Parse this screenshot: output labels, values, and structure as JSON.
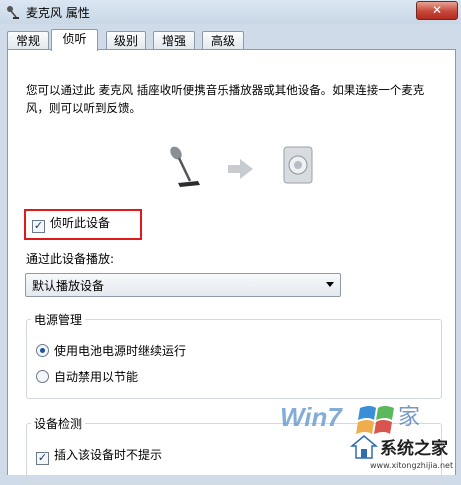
{
  "window": {
    "title": "麦克风 属性",
    "close_label": "✕"
  },
  "tabs": [
    {
      "label": "常规",
      "active": false
    },
    {
      "label": "侦听",
      "active": true
    },
    {
      "label": "级别",
      "active": false
    },
    {
      "label": "增强",
      "active": false
    },
    {
      "label": "高级",
      "active": false
    }
  ],
  "listen": {
    "description": "您可以通过此 麦克风 插座收听便携音乐播放器或其他设备。如果连接一个麦克风，则可以听到反馈。",
    "listen_checkbox": {
      "label": "侦听此设备",
      "checked": true
    },
    "playback_label": "通过此设备播放:",
    "playback_device": "默认播放设备"
  },
  "power": {
    "title": "电源管理",
    "options": [
      {
        "label": "使用电池电源时继续运行",
        "selected": true
      },
      {
        "label": "自动禁用以节能",
        "selected": false
      }
    ]
  },
  "detection": {
    "title": "设备检测",
    "checkbox": {
      "label": "插入该设备时不提示",
      "checked": true
    }
  },
  "watermark": {
    "brand": "Win7",
    "site_name": "系统之家",
    "url": "www.xitongzhijia.net"
  }
}
